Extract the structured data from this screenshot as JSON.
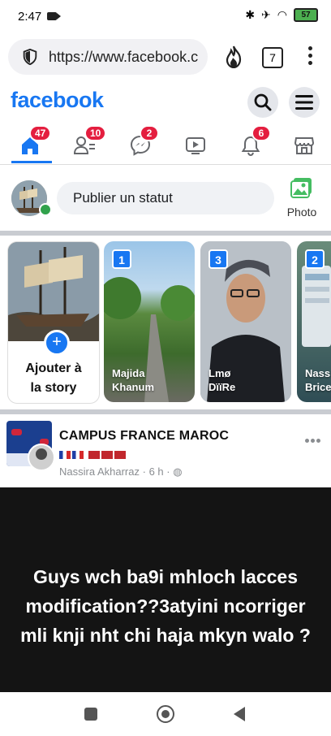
{
  "status_bar": {
    "time": "2:47",
    "battery": "57"
  },
  "browser": {
    "url": "https://www.facebook.c",
    "tab_count": "7"
  },
  "facebook": {
    "logo": "facebook",
    "nav": {
      "home_badge": "47",
      "friends_badge": "10",
      "messenger_badge": "2",
      "notifications_badge": "6"
    },
    "composer": {
      "placeholder": "Publier un statut",
      "photo_label": "Photo"
    },
    "stories": {
      "add_story_label_line1": "Ajouter à",
      "add_story_label_line2": "la story",
      "items": [
        {
          "count": "1",
          "name_line1": "Majida",
          "name_line2": "Khanum"
        },
        {
          "count": "3",
          "name_line1": "Lmø",
          "name_line2": "DïïRe"
        },
        {
          "count": "2",
          "name_line1": "Nass",
          "name_line2": "Brice"
        }
      ]
    },
    "post": {
      "page_name": "CAMPUS FRANCE MAROC",
      "author": "Nassira Akharraz",
      "time": "6 h",
      "text": "Guys wch ba9i mhloch lacces modification??3atyini ncorriger mli knji nht chi haja mkyn walo ?"
    }
  }
}
